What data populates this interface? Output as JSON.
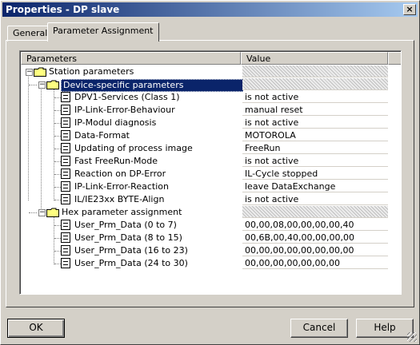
{
  "window": {
    "title": "Properties - DP slave",
    "close_glyph": "×"
  },
  "tabs": [
    {
      "label": "General",
      "active": false
    },
    {
      "label": "Parameter Assignment",
      "active": true
    }
  ],
  "grid": {
    "col_parameters": "Parameters",
    "col_value": "Value"
  },
  "tree": {
    "station": "Station parameters",
    "device_group": "Device-specific parameters",
    "device_params": [
      {
        "label": "DPV1-Services (Class 1)",
        "value": "is not active"
      },
      {
        "label": "IP-Link-Error-Behaviour",
        "value": "manual reset"
      },
      {
        "label": "IP-Modul diagnosis",
        "value": "is not active"
      },
      {
        "label": "Data-Format",
        "value": "MOTOROLA"
      },
      {
        "label": "Updating of process image",
        "value": "FreeRun"
      },
      {
        "label": "Fast FreeRun-Mode",
        "value": "is not active"
      },
      {
        "label": "Reaction on DP-Error",
        "value": "IL-Cycle stopped"
      },
      {
        "label": "IP-Link-Error-Reaction",
        "value": "leave DataExchange"
      },
      {
        "label": "IL/IE23xx BYTE-Align",
        "value": "is not active"
      }
    ],
    "hex_group": "Hex parameter assignment",
    "hex_params": [
      {
        "label": "User_Prm_Data (0 to 7)",
        "value": "00,00,08,00,00,00,00,40"
      },
      {
        "label": "User_Prm_Data (8 to 15)",
        "value": "00,6B,00,40,00,00,00,00"
      },
      {
        "label": "User_Prm_Data (16 to 23)",
        "value": "00,00,00,00,00,00,00,00"
      },
      {
        "label": "User_Prm_Data (24 to 30)",
        "value": "00,00,00,00,00,00,00"
      }
    ]
  },
  "buttons": {
    "ok": "OK",
    "cancel": "Cancel",
    "help": "Help"
  },
  "colors": {
    "selection": "#0a246a",
    "face": "#d4d0c8",
    "folder": "#ffff80"
  },
  "icons": {
    "folder": "folder-icon",
    "document": "parameter-document-icon",
    "expand": "minus-expander-icon"
  }
}
